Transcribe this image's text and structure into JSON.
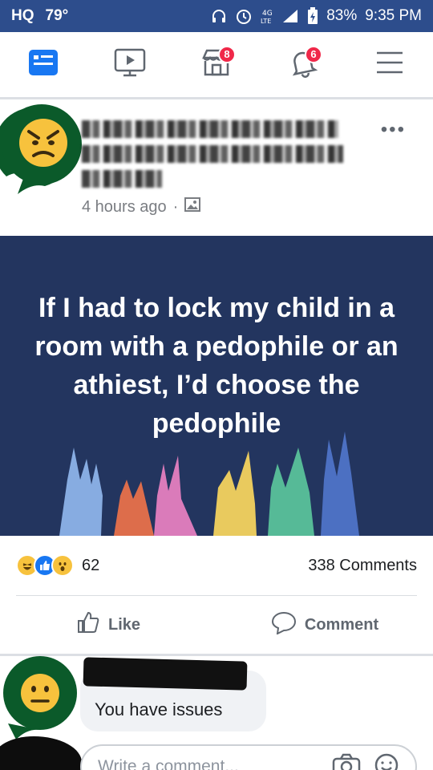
{
  "status_bar": {
    "left_label": "HQ",
    "temperature": "79°",
    "battery": "83%",
    "time": "9:35 PM",
    "network": "4G LTE",
    "icons": [
      "headphones-icon",
      "alarm-icon",
      "signal-icon",
      "battery-icon"
    ]
  },
  "nav": {
    "items": [
      {
        "name": "news-feed",
        "icon": "news-feed-icon",
        "active": true
      },
      {
        "name": "watch",
        "icon": "video-icon"
      },
      {
        "name": "marketplace",
        "icon": "marketplace-icon",
        "badge": "8"
      },
      {
        "name": "notifications",
        "icon": "bell-icon",
        "badge": "6"
      },
      {
        "name": "menu",
        "icon": "hamburger-icon"
      }
    ],
    "accent": "#1877f2",
    "badge_color": "#f02849"
  },
  "post": {
    "timestamp": "4 hours ago",
    "separator": "·",
    "image_text": "If I had to lock my child in a room with a pedophile or an athiest, I’d choose the pedophile",
    "image_bg": "#23355f",
    "reactions_count": "62",
    "reaction_icons": [
      "haha-icon",
      "like-icon",
      "wow-icon"
    ],
    "comments_label": "338 Comments",
    "actions": {
      "like": "Like",
      "comment": "Comment"
    }
  },
  "comments": [
    {
      "text": "You have issues",
      "author_redacted": true
    }
  ],
  "composer": {
    "placeholder": "Write a comment..."
  }
}
